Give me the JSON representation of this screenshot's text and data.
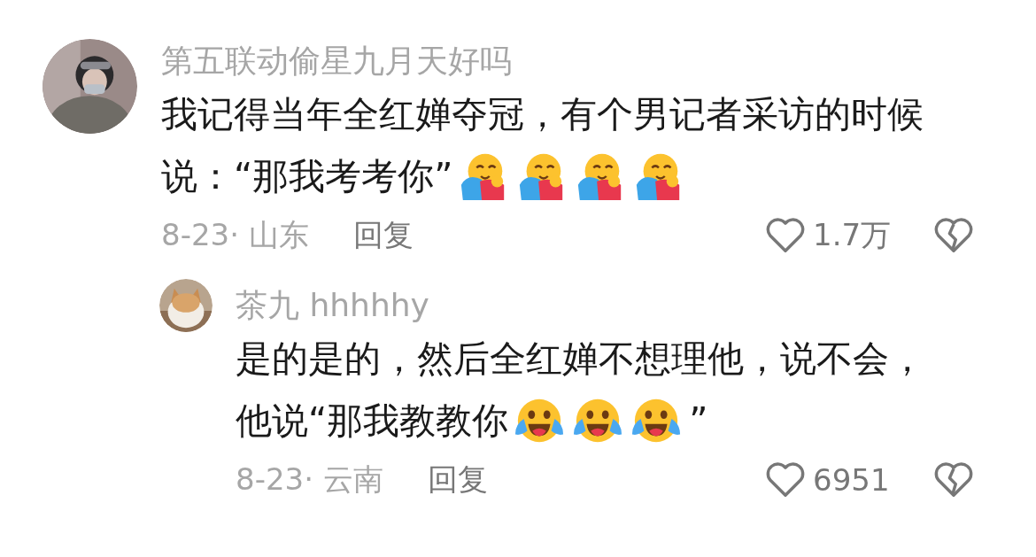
{
  "comments": [
    {
      "author": "第五联动偷星九月天好吗",
      "avatar": {
        "kind": "picture"
      },
      "lines": [
        [
          {
            "kind": "text",
            "text": "我记得当年全红婵夺冠，有个男记者采访的时候"
          }
        ],
        [
          {
            "kind": "text",
            "text": "说：“那我考考你”"
          },
          {
            "kind": "hug"
          },
          {
            "kind": "hug"
          },
          {
            "kind": "hug"
          },
          {
            "kind": "hug"
          }
        ]
      ],
      "meta": "8-23· 山东",
      "reply_label": "回复",
      "likes": "1.7万"
    },
    {
      "author": "茶九 hhhhhy",
      "avatar": {
        "kind": "picture"
      },
      "lines": [
        [
          {
            "kind": "text",
            "text": "是的是的，然后全红婵不想理他，说不会，"
          }
        ],
        [
          {
            "kind": "text",
            "text": "他说“那我教教你"
          },
          {
            "kind": "tears"
          },
          {
            "kind": "tears"
          },
          {
            "kind": "tears"
          },
          {
            "kind": "text",
            "text": "”"
          }
        ]
      ],
      "meta": "8-23· 云南",
      "reply_label": "回复",
      "likes": "6951"
    }
  ]
}
